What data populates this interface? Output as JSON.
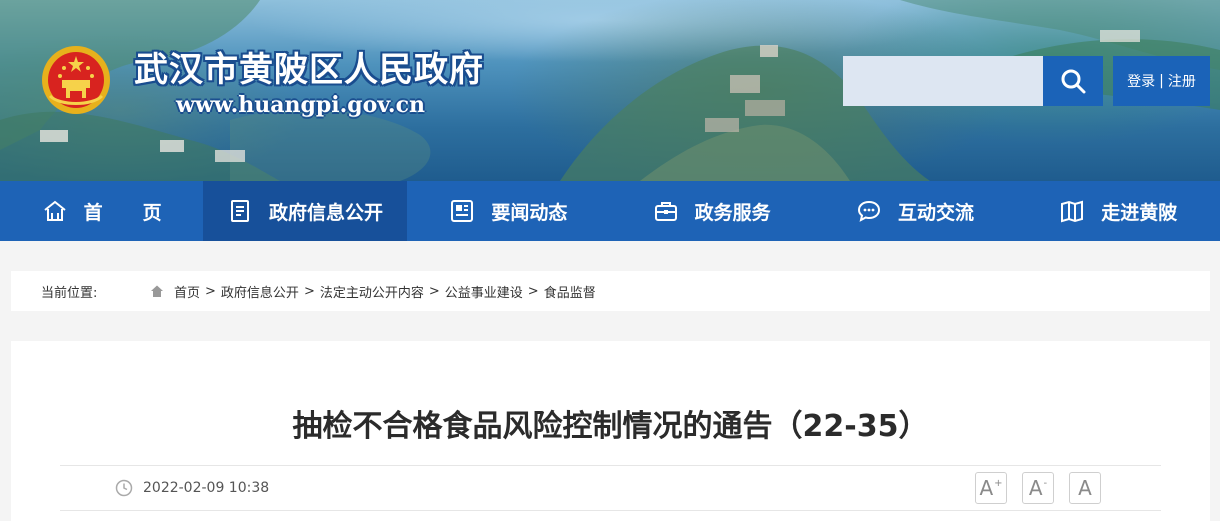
{
  "header": {
    "site_name": "武汉市黄陂区人民政府",
    "site_url": "www.huangpi.gov.cn",
    "search": {
      "placeholder": "",
      "button_icon": "search-icon"
    },
    "auth": {
      "login": "登录",
      "separator": "|",
      "register": "注册"
    },
    "colors": {
      "button_blue": "#1b63b8",
      "title_outline": "#1a4d8f"
    }
  },
  "nav": {
    "items": [
      {
        "label": "首页",
        "icon": "home-icon",
        "active": false
      },
      {
        "label": "政府信息公开",
        "icon": "document-icon",
        "active": true
      },
      {
        "label": "要闻动态",
        "icon": "news-icon",
        "active": false
      },
      {
        "label": "政务服务",
        "icon": "briefcase-icon",
        "active": false
      },
      {
        "label": "互动交流",
        "icon": "chat-icon",
        "active": false
      },
      {
        "label": "走进黄陂",
        "icon": "book-icon",
        "active": false
      }
    ],
    "colors": {
      "bar": "#1e63b6",
      "active": "#17509a"
    }
  },
  "breadcrumb": {
    "prefix": "当前位置:",
    "separator": ">",
    "items": [
      "首页",
      "政府信息公开",
      "法定主动公开内容",
      "公益事业建设",
      "食品监督"
    ]
  },
  "article": {
    "title": "抽检不合格食品风险控制情况的通告（22-35）",
    "date": "2022-02-09 10:38",
    "font_controls": [
      {
        "label": "A",
        "mark": "+",
        "action": "increase"
      },
      {
        "label": "A",
        "mark": "-",
        "action": "decrease"
      },
      {
        "label": "A",
        "mark": "",
        "action": "reset"
      }
    ]
  }
}
